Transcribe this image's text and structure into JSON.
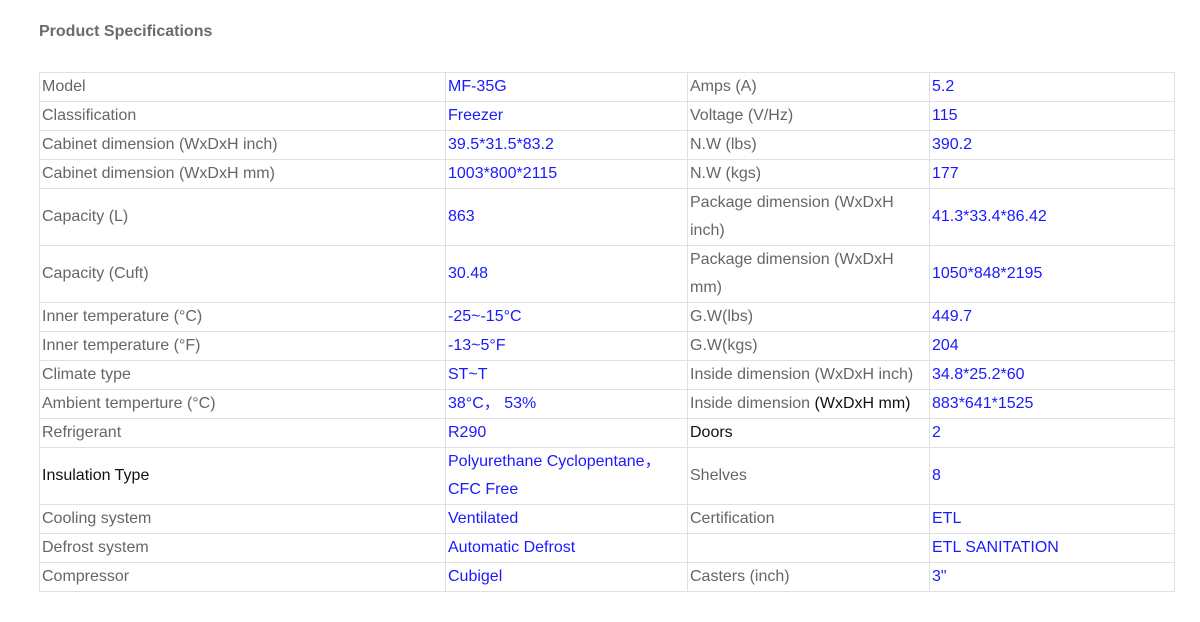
{
  "title": "Product Specifications",
  "rows": [
    [
      "Model",
      "MF-35G",
      "Amps (A)",
      "5.2"
    ],
    [
      "Classification",
      "Freezer",
      "Voltage (V/Hz)",
      "115"
    ],
    [
      "Cabinet dimension (WxDxH inch)",
      "39.5*31.5*83.2",
      "N.W (lbs)",
      "390.2"
    ],
    [
      "Cabinet dimension (WxDxH mm)",
      "1003*800*2115",
      "N.W (kgs)",
      "177"
    ],
    [
      "Capacity (L)",
      "863",
      "Package dimension (WxDxH inch)",
      "41.3*33.4*86.42"
    ],
    [
      "Capacity (Cuft)",
      "30.48",
      "Package dimension (WxDxH mm)",
      "1050*848*2195"
    ],
    [
      "Inner temperature (°C)",
      "-25~-15°C",
      "G.W(lbs)",
      "449.7"
    ],
    [
      "Inner temperature (°F)",
      "-13~5°F",
      "G.W(kgs)",
      "204"
    ],
    [
      "Climate type",
      "ST~T",
      "Inside dimension (WxDxH inch)",
      "34.8*25.2*60"
    ],
    [
      "Ambient temperture (°C)",
      "38°C， 53%",
      "Inside dimension ",
      "883*641*1525"
    ],
    [
      "Refrigerant",
      "R290",
      "Doors",
      "2"
    ],
    [
      "Insulation Type",
      "Polyurethane Cyclopentane，CFC Free",
      "Shelves",
      "8"
    ],
    [
      "Cooling system",
      "Ventilated",
      "Certification",
      "ETL"
    ],
    [
      "Defrost system",
      "Automatic Defrost",
      "",
      "ETL SANITATION"
    ],
    [
      "Compressor",
      "Cubigel",
      "Casters (inch)",
      "3\""
    ]
  ],
  "ambient_inside_dim_suffix": "(WxDxH mm)"
}
